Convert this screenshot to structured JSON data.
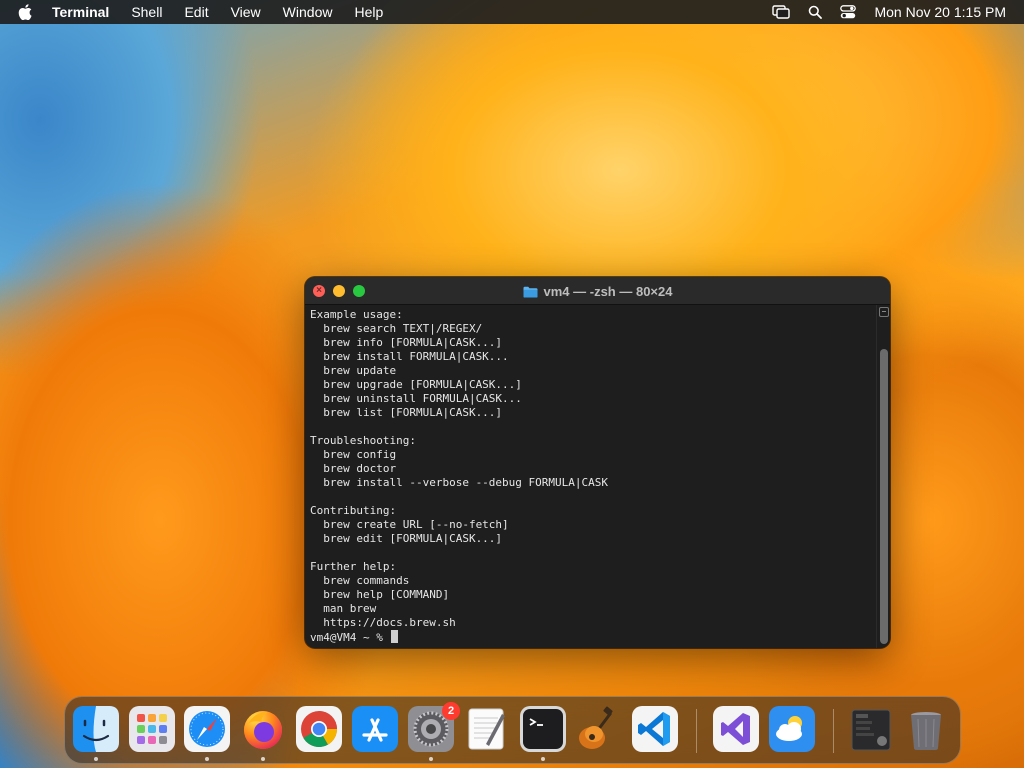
{
  "menubar": {
    "app_name": "Terminal",
    "menus": [
      "Shell",
      "Edit",
      "View",
      "Window",
      "Help"
    ],
    "datetime": "Mon Nov 20  1:15 PM",
    "status_icons": [
      "screen-mirroring-icon",
      "spotlight-search-icon",
      "control-center-icon"
    ]
  },
  "window": {
    "title": "vm4 — -zsh — 80×24",
    "lines": [
      "Example usage:",
      "  brew search TEXT|/REGEX/",
      "  brew info [FORMULA|CASK...]",
      "  brew install FORMULA|CASK...",
      "  brew update",
      "  brew upgrade [FORMULA|CASK...]",
      "  brew uninstall FORMULA|CASK...",
      "  brew list [FORMULA|CASK...]",
      "",
      "Troubleshooting:",
      "  brew config",
      "  brew doctor",
      "  brew install --verbose --debug FORMULA|CASK",
      "",
      "Contributing:",
      "  brew create URL [--no-fetch]",
      "  brew edit [FORMULA|CASK...]",
      "",
      "Further help:",
      "  brew commands",
      "  brew help [COMMAND]",
      "  man brew",
      "  https://docs.brew.sh"
    ],
    "prompt": "vm4@VM4 ~ % "
  },
  "dock": {
    "items": [
      {
        "name": "finder",
        "icon": "finder-icon",
        "running": true
      },
      {
        "name": "launchpad",
        "icon": "launchpad-icon",
        "running": false
      },
      {
        "name": "safari",
        "icon": "safari-icon",
        "running": true
      },
      {
        "name": "firefox",
        "icon": "firefox-icon",
        "running": true
      },
      {
        "name": "chrome",
        "icon": "chrome-icon",
        "running": false
      },
      {
        "name": "app-store",
        "icon": "app-store-icon",
        "running": false
      },
      {
        "name": "system-settings",
        "icon": "system-settings-icon",
        "running": true,
        "badge": "2"
      },
      {
        "name": "textedit",
        "icon": "textedit-icon",
        "running": false
      },
      {
        "name": "terminal",
        "icon": "terminal-icon",
        "running": true
      },
      {
        "name": "garageband",
        "icon": "garageband-icon",
        "running": false
      },
      {
        "name": "vscode",
        "icon": "vscode-icon",
        "running": false
      },
      {
        "name": "visual-studio",
        "icon": "visual-studio-icon",
        "running": false
      },
      {
        "name": "weather",
        "icon": "weather-icon",
        "running": false
      },
      {
        "name": "downloads-stack",
        "icon": "downloads-stack-icon",
        "running": false
      },
      {
        "name": "trash",
        "icon": "trash-icon",
        "running": false
      }
    ]
  }
}
